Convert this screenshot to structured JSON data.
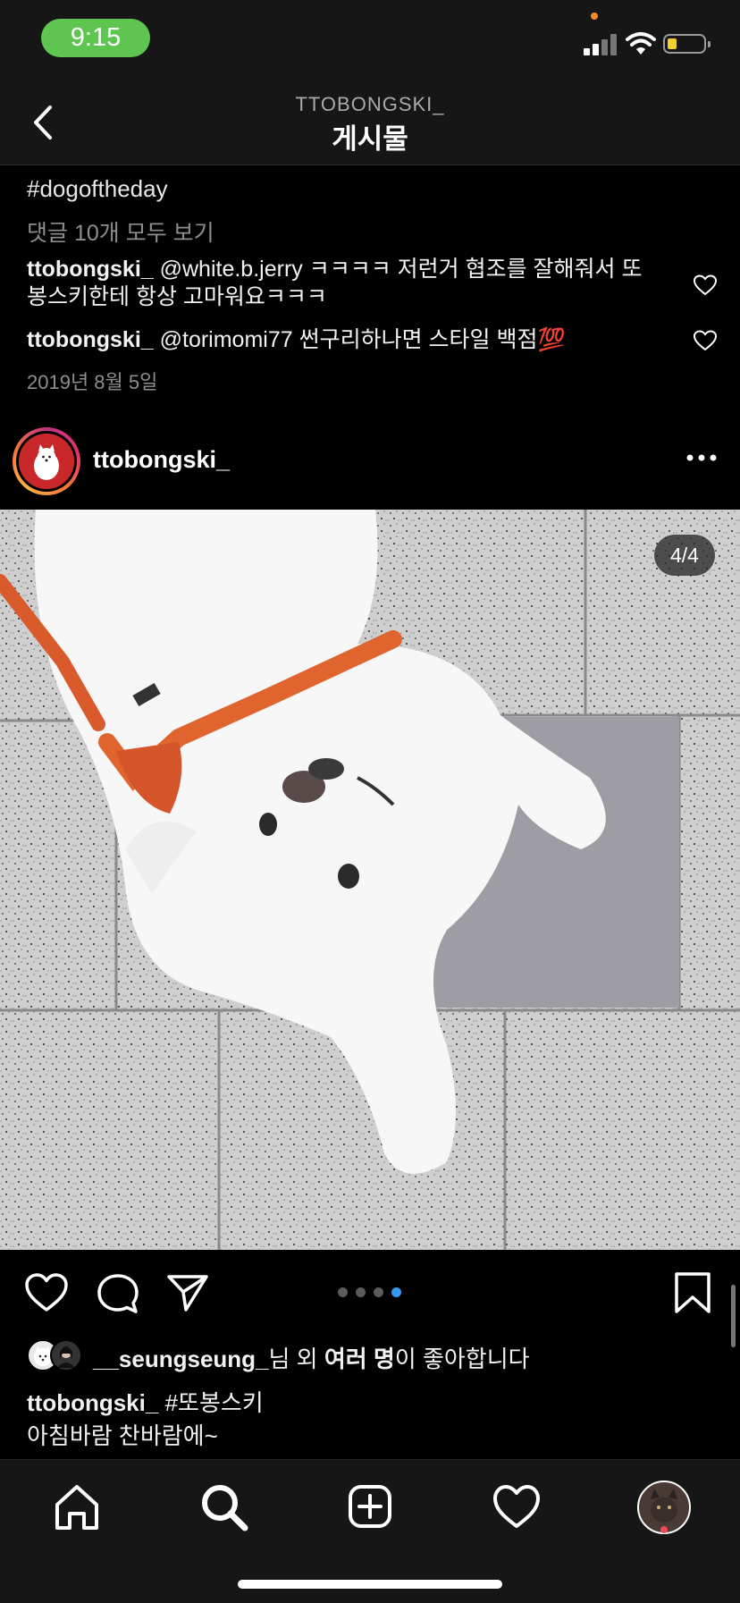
{
  "status_bar": {
    "time": "9:15"
  },
  "header": {
    "username": "TTOBONGSKI_",
    "title": "게시물"
  },
  "previous_post": {
    "hashtag": "#dogoftheday",
    "view_comments": "댓글 10개 모두 보기",
    "comments": [
      {
        "user": "ttobongski_",
        "text": "@white.b.jerry ㅋㅋㅋㅋ 저런거 협조를 잘해줘서 또봉스키한테 항상 고마워요ㅋㅋㅋ"
      },
      {
        "user": "ttobongski_",
        "text": "@torimomi77 썬구리하나면 스타일 백점💯"
      }
    ],
    "date": "2019년 8월 5일"
  },
  "post": {
    "username": "ttobongski_",
    "image_counter": "4/4",
    "carousel": {
      "count": 4,
      "active_index": 3
    },
    "likes": {
      "user": "__seungseung_",
      "text_1": "님 외 ",
      "text_bold": "여러 명",
      "text_2": "이 좋아합니다"
    },
    "caption": {
      "user": "ttobongski_",
      "hashtag": "#또봉스키",
      "line_2": "아침바람 찬바람에~"
    }
  },
  "tabbar": {
    "icons": [
      "home-icon",
      "search-icon",
      "new-post-icon",
      "activity-heart-icon",
      "profile-avatar"
    ]
  },
  "colors": {
    "background": "#000000",
    "time_pill": "#5ec551",
    "active_dot": "#3897f0",
    "notification": "#ed4956"
  }
}
